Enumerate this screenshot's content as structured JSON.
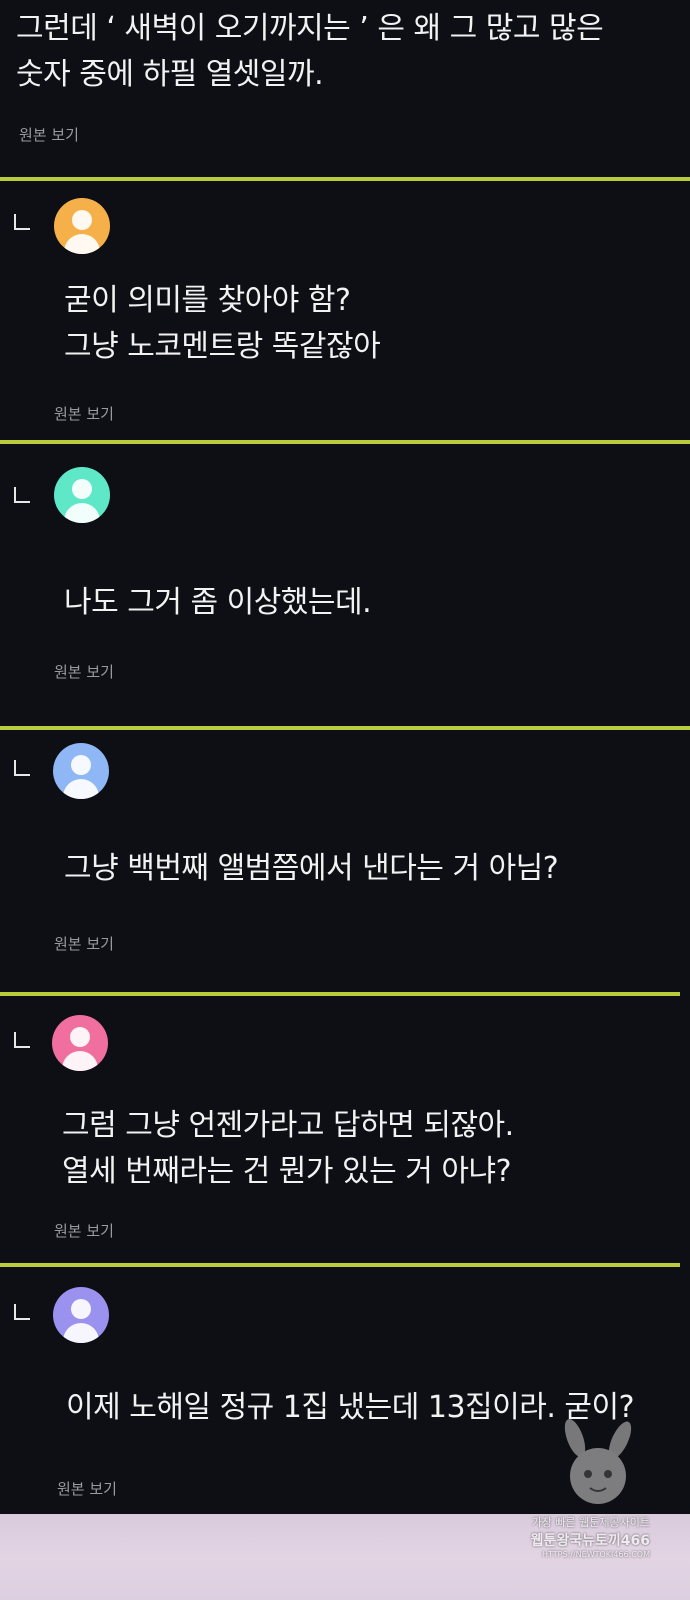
{
  "top": {
    "text": "그런데 ‘ 새벽이 오기까지는 ’ 은 왜 그 많고 많은\n숫자 중에 하필 열셋일까.",
    "view_label": "원본 보기"
  },
  "comments": [
    {
      "text": "굳이 의미를 찾아야 함?\n그냥 노코멘트랑 똑같잖아",
      "view_label": "원본 보기",
      "avatar_color": "#f6b04a"
    },
    {
      "text": "나도 그거 좀 이상했는데.",
      "view_label": "원본 보기",
      "avatar_color": "#5ee8c8"
    },
    {
      "text": "그냥 백번째 앨범쯤에서 낸다는 거 아님?",
      "view_label": "원본 보기",
      "avatar_color": "#8fb6f5"
    },
    {
      "text": "그럼 그냥 언젠가라고 답하면 되잖아.\n열세 번째라는 건 뭔가 있는 거 아냐?",
      "view_label": "원본 보기",
      "avatar_color": "#f06f9e"
    },
    {
      "text": "이제 노해일 정규 1집 냈는데 13집이라. 굳이?",
      "view_label": "원본 보기",
      "avatar_color": "#9a92ee"
    }
  ],
  "colors": {
    "background": "#0e0f15",
    "divider": "#b8cc3c",
    "text": "#f2f2f2",
    "muted_text": "#9a9a9f"
  },
  "reply_icon": "reply-corner-icon",
  "avatar_icon": "user-avatar-icon",
  "watermark": {
    "line1": "가장 빠른 웹툰제공사이트",
    "line2": "웹툰왕국뉴토끼466",
    "line3": "HTTPS://NEWTOKI466.COM"
  }
}
